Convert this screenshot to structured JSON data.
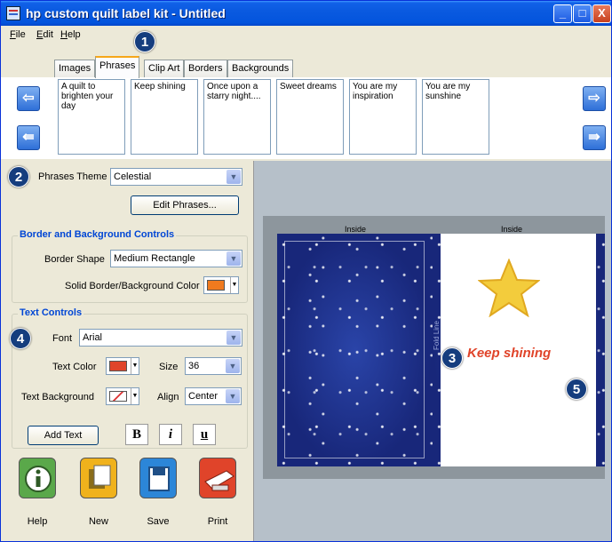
{
  "window": {
    "title": "hp custom quilt label kit - Untitled"
  },
  "window_controls": {
    "minimize": "_",
    "maximize": "□",
    "close": "X"
  },
  "menu": [
    {
      "label": "File",
      "accel": "F",
      "rest": "ile"
    },
    {
      "label": "Edit",
      "accel": "E",
      "rest": "dit"
    },
    {
      "label": "Help",
      "accel": "H",
      "rest": "elp"
    }
  ],
  "callouts": [
    "1",
    "2",
    "3",
    "4",
    "5"
  ],
  "tabs": [
    "Images",
    "Phrases",
    "Clip Art",
    "Borders",
    "Backgrounds"
  ],
  "active_tab": "Phrases",
  "phrases": [
    "A quilt to brighten your day",
    "Keep shining",
    "Once upon a starry night....",
    "Sweet dreams",
    "You are my inspiration",
    "You are my sunshine"
  ],
  "nav": {
    "prev": "⇦",
    "first": "⇚",
    "next": "⇨",
    "last": "⇛"
  },
  "phrases_theme": {
    "label": "Phrases Theme",
    "value": "Celestial"
  },
  "edit_phrases_button": "Edit Phrases...",
  "border_bg": {
    "title": "Border and Background Controls",
    "shape_label": "Border Shape",
    "shape_value": "Medium Rectangle",
    "color_label": "Solid Border/Background Color",
    "color": "#f07a1e"
  },
  "text_controls": {
    "title": "Text Controls",
    "font_label": "Font",
    "font_value": "Arial",
    "color_label": "Text Color",
    "color": "#e0442a",
    "size_label": "Size",
    "size_value": "36",
    "bg_label": "Text Background",
    "align_label": "Align",
    "align_value": "Center",
    "add_text_button": "Add Text",
    "bold": "B",
    "italic": "i",
    "underline": "u"
  },
  "toolbar": [
    {
      "label": "Help",
      "icon": "info-icon",
      "color": "#5aa84a"
    },
    {
      "label": "New",
      "icon": "new-document-icon",
      "color": "#f0b21c"
    },
    {
      "label": "Save",
      "icon": "floppy-disk-icon",
      "color": "#2c86d8"
    },
    {
      "label": "Print",
      "icon": "printer-icon",
      "color": "#e0442a"
    }
  ],
  "preview": {
    "inside_left": "Inside",
    "inside_right": "Inside",
    "fold_line": "Fold Line",
    "label_text": "Keep shining",
    "label_text_color": "#e0442a"
  }
}
